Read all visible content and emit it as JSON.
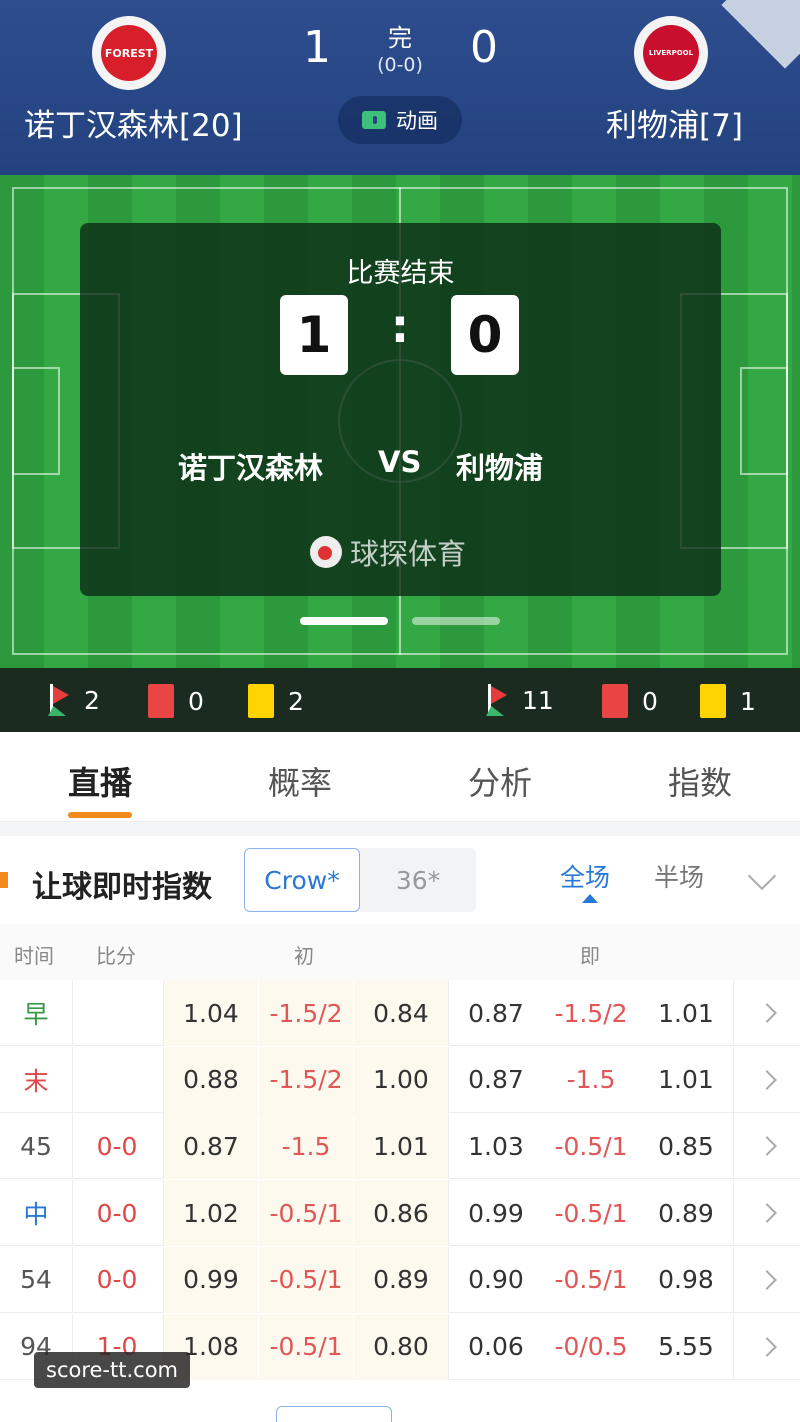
{
  "match": {
    "home_team": "诺丁汉森林[20]",
    "away_team": "利物浦[7]",
    "home_score": "1",
    "away_score": "0",
    "status": "完",
    "half_score": "(0-0)",
    "animation_label": "动画",
    "home_logo_text": "FOREST",
    "away_logo_text": "LIVERPOOL"
  },
  "overlay": {
    "title": "比赛结束",
    "home_score": "1",
    "away_score": "0",
    "colon": ":",
    "home": "诺丁汉森林",
    "vs": "VS",
    "away": "利物浦",
    "brand": "球探体育"
  },
  "stats": {
    "home_corners": "2",
    "home_red": "0",
    "home_yellow": "2",
    "away_corners": "11",
    "away_red": "0",
    "away_yellow": "1"
  },
  "tabs": [
    {
      "label": "直播",
      "active": true
    },
    {
      "label": "概率",
      "active": false
    },
    {
      "label": "分析",
      "active": false
    },
    {
      "label": "指数",
      "active": false
    }
  ],
  "section": {
    "title": "让球即时指数",
    "company_selected": "Crow*",
    "company_other": "36*",
    "seg_full": "全场",
    "seg_half": "半场"
  },
  "table": {
    "headers": {
      "time": "时间",
      "score": "比分",
      "initial": "初",
      "live": "即"
    },
    "rows": [
      {
        "time": "早",
        "time_color": "#3a9a4a",
        "score": "",
        "h1": "1.04",
        "l1": "-1.5/2",
        "a1": "0.84",
        "h2": "0.87",
        "l2": "-1.5/2",
        "a2": "1.01"
      },
      {
        "time": "末",
        "time_color": "#e04848",
        "score": "",
        "h1": "0.88",
        "l1": "-1.5/2",
        "a1": "1.00",
        "h2": "0.87",
        "l2": "-1.5",
        "a2": "1.01"
      },
      {
        "time": "45",
        "time_color": "#555555",
        "score": "0-0",
        "h1": "0.87",
        "l1": "-1.5",
        "a1": "1.01",
        "h2": "1.03",
        "l2": "-0.5/1",
        "a2": "0.85"
      },
      {
        "time": "中",
        "time_color": "#2a78d6",
        "score": "0-0",
        "h1": "1.02",
        "l1": "-0.5/1",
        "a1": "0.86",
        "h2": "0.99",
        "l2": "-0.5/1",
        "a2": "0.89"
      },
      {
        "time": "54",
        "time_color": "#555555",
        "score": "0-0",
        "h1": "0.99",
        "l1": "-0.5/1",
        "a1": "0.89",
        "h2": "0.90",
        "l2": "-0.5/1",
        "a2": "0.98"
      },
      {
        "time": "94",
        "time_color": "#555555",
        "score": "1-0",
        "h1": "1.08",
        "l1": "-0.5/1",
        "a1": "0.80",
        "h2": "0.06",
        "l2": "-0/0.5",
        "a2": "5.55"
      }
    ]
  },
  "watermark": "score-tt.com"
}
